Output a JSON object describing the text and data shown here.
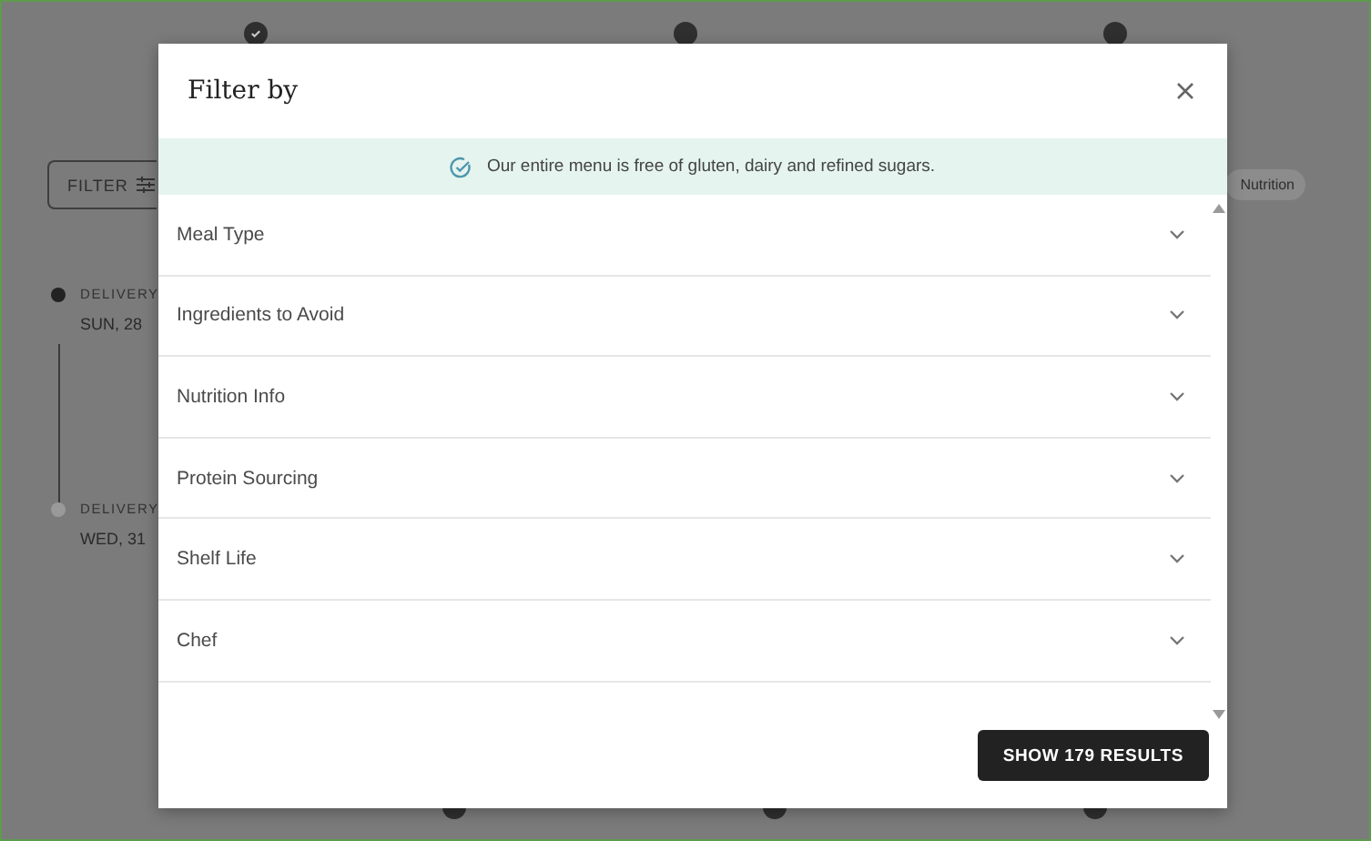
{
  "background": {
    "steps": [
      {
        "kind": "done"
      },
      {
        "kind": "pending"
      },
      {
        "kind": "pending"
      }
    ],
    "filter_button": {
      "label": "FILTER"
    },
    "chip": {
      "label": "Nutrition"
    },
    "deliveries": [
      {
        "label": "DELIVERY",
        "date": "SUN, 28",
        "current": true
      },
      {
        "label": "DELIVERY",
        "date": "WED, 31",
        "current": false
      }
    ]
  },
  "dialog": {
    "title": "Filter by",
    "banner": "Our entire menu is free of gluten, dairy and refined sugars.",
    "sections": [
      {
        "label": "Meal Type",
        "expanded": false
      },
      {
        "label": "Ingredients to Avoid",
        "expanded": false
      },
      {
        "label": "Nutrition Info",
        "expanded": false
      },
      {
        "label": "Protein Sourcing",
        "expanded": false
      },
      {
        "label": "Shelf Life",
        "expanded": false
      },
      {
        "label": "Chef",
        "expanded": false
      }
    ],
    "button": "SHOW 179 RESULTS"
  }
}
